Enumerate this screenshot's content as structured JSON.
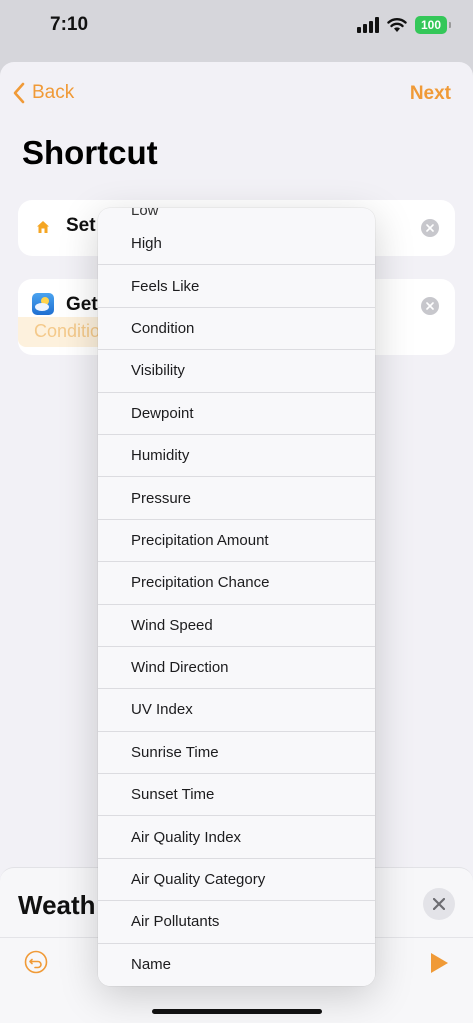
{
  "status_bar": {
    "time": "7:10",
    "battery": "100"
  },
  "nav": {
    "back_label": "Back",
    "next_label": "Next"
  },
  "page_title": "Shortcut",
  "actions": [
    {
      "label": "Set"
    },
    {
      "label": "Get",
      "parameter": "Condition"
    }
  ],
  "bottom_panel": {
    "title": "Weath"
  },
  "menu": {
    "partial_item": "Low",
    "items": [
      "High",
      "Feels Like",
      "Condition",
      "Visibility",
      "Dewpoint",
      "Humidity",
      "Pressure",
      "Precipitation Amount",
      "Precipitation Chance",
      "Wind Speed",
      "Wind Direction",
      "UV Index",
      "Sunrise Time",
      "Sunset Time",
      "Air Quality Index",
      "Air Quality Category",
      "Air Pollutants",
      "Name"
    ]
  },
  "colors": {
    "accent": "#f09a37",
    "battery": "#34c759"
  }
}
